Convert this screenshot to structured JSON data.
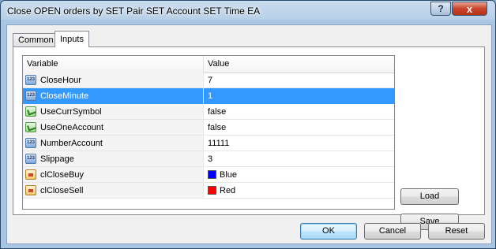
{
  "window": {
    "title": "Close OPEN orders by SET Pair SET Account SET Time EA"
  },
  "titlebar": {
    "help_label": "?",
    "close_label": "x"
  },
  "tabs": [
    {
      "label": "Common"
    },
    {
      "label": "Inputs"
    }
  ],
  "grid": {
    "columns": {
      "variable": "Variable",
      "value": "Value"
    },
    "rows": [
      {
        "variable": "CloseHour",
        "value": "7",
        "icon": "number-icon"
      },
      {
        "variable": "CloseMinute",
        "value": "1",
        "icon": "number-icon"
      },
      {
        "variable": "UseCurrSymbol",
        "value": "false",
        "icon": "boolean-icon"
      },
      {
        "variable": "UseOneAccount",
        "value": "false",
        "icon": "boolean-icon"
      },
      {
        "variable": "NumberAccount",
        "value": "11111",
        "icon": "number-icon"
      },
      {
        "variable": "Slippage",
        "value": "3",
        "icon": "number-icon"
      },
      {
        "variable": "clCloseBuy",
        "value": "Blue",
        "icon": "color-icon",
        "color": "#0000ff"
      },
      {
        "variable": "clCloseSell",
        "value": "Red",
        "icon": "color-icon",
        "color": "#ff0000"
      }
    ],
    "selected_row": "CloseMinute"
  },
  "side_buttons": {
    "load": "Load",
    "save": "Save"
  },
  "footer_buttons": {
    "ok": "OK",
    "cancel": "Cancel",
    "reset": "Reset"
  },
  "colors": {
    "selection": "#3399ff",
    "window_frame": "#a9c6e2"
  }
}
